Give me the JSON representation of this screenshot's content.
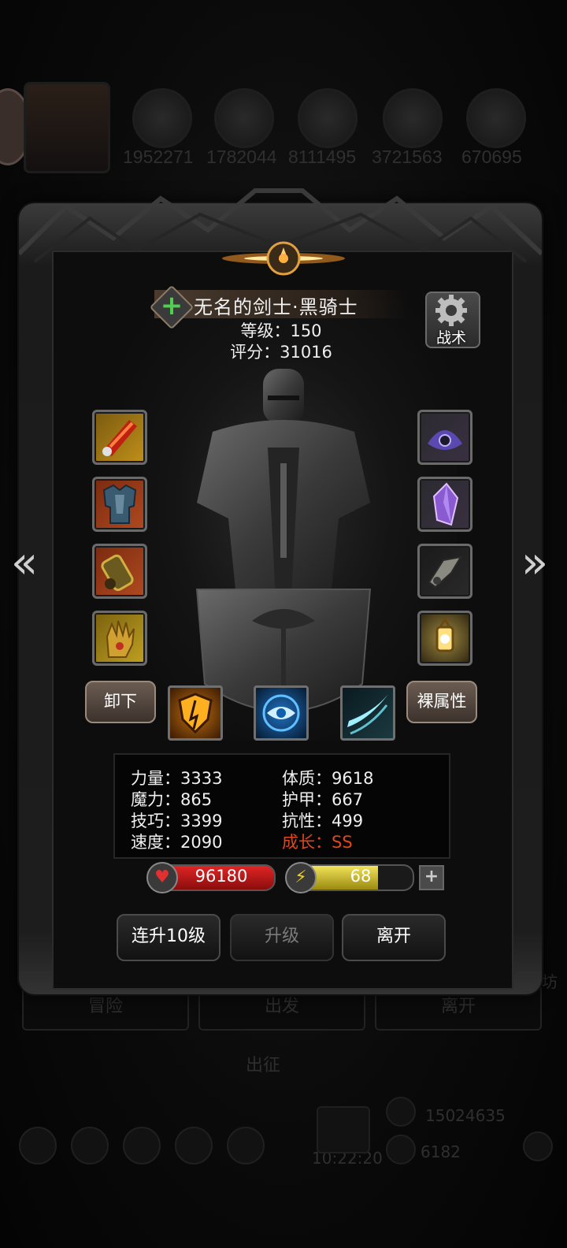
{
  "background": {
    "resources": [
      "1952271",
      "1782044",
      "8111495",
      "3721563",
      "670695"
    ],
    "tabs": [
      "冒险",
      "出发",
      "离开"
    ],
    "expedition_label": "出征",
    "gold": "15024635",
    "gems": "6182",
    "clock": "10:22:20",
    "side_text": "工坊"
  },
  "hero": {
    "name": "无名的剑士·黑骑士",
    "level": "等级：150",
    "score": "评分：31016",
    "tactic_label": "战术"
  },
  "equipment_left": [
    "flame-gauntlet-icon",
    "chest-armor-icon",
    "bracer-icon",
    "golden-glove-icon"
  ],
  "equipment_right": [
    "dark-amulet-icon",
    "purple-crystal-icon",
    "ring-icon",
    "lantern-icon"
  ],
  "actions": {
    "unequip": "卸下",
    "bare_stats": "裸属性",
    "level_up_10": "连升10级",
    "level_up": "升级",
    "leave": "离开"
  },
  "skills": [
    "shield-skill-icon",
    "eye-skill-icon",
    "slash-skill-icon"
  ],
  "stats": {
    "strength": "力量：3333",
    "magic": "魔力：865",
    "skill": "技巧：3399",
    "speed": "速度：2090",
    "constitution": "体质：9618",
    "armor": "护甲：667",
    "resistance": "抗性：499",
    "growth": "成长：SS"
  },
  "bars": {
    "hp": "96180",
    "energy": "68",
    "energy_fill_percent": 72
  },
  "colors": {
    "growth_text": "#e0461e",
    "hp_bar": "#e02525",
    "energy_bar": "#f2e35a",
    "plus_green": "#4fd04f"
  }
}
